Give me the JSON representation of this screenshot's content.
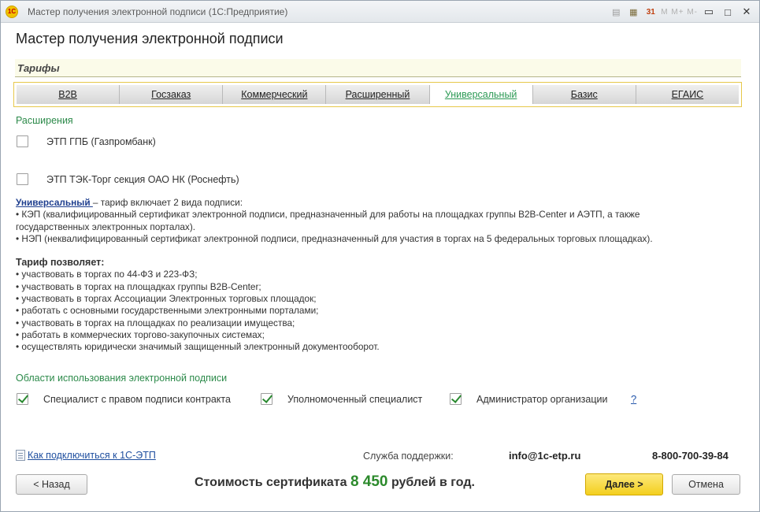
{
  "window": {
    "title": "Мастер получения электронной подписи  (1С:Предприятие)",
    "logo_text": "1C",
    "memory_buttons": "M  M+  M-",
    "calendar_day": "31"
  },
  "page": {
    "title": "Мастер получения электронной подписи",
    "tariffs_header": "Тарифы"
  },
  "tabs": [
    {
      "label": "B2B",
      "active": false
    },
    {
      "label": "Госзаказ",
      "active": false
    },
    {
      "label": "Коммерческий",
      "active": false
    },
    {
      "label": "Расширенный",
      "active": false
    },
    {
      "label": "Универсальный",
      "active": true
    },
    {
      "label": "Базис",
      "active": false
    },
    {
      "label": "ЕГАИС",
      "active": false
    }
  ],
  "extensions": {
    "label": "Расширения",
    "items": [
      {
        "label": "ЭТП ГПБ (Газпромбанк)",
        "checked": false
      },
      {
        "label": "ЭТП ТЭК-Торг секция ОАО НК (Роснефть)",
        "checked": false
      }
    ]
  },
  "description": {
    "keyword": "Универсальный ",
    "intro": " – тариф включает 2 вида подписи:",
    "bullets": [
      "• КЭП (квалифицированный сертификат электронной подписи, предназначенный для работы на площадках группы B2B-Center и АЭТП, а также",
      "государственных электронных порталах).",
      "• НЭП (неквалифицированный сертификат электронной подписи, предназначенный для участия в торгах на 5 федеральных торговых площадках)."
    ],
    "allows_title": "Тариф позволяет:",
    "allows": [
      "• участвовать в торгах по 44-ФЗ и 223-ФЗ;",
      "• участвовать в торгах на площадках группы B2B-Center;",
      "• участвовать в торгах Ассоциации Электронных торговых площадок;",
      "• работать с основными государственными электронными порталами;",
      "• участвовать в торгах на площадках по реализации имущества;",
      "• работать в коммерческих торгово-закупочных системах;",
      "• осуществлять юридически значимый защищенный электронный документооборот."
    ]
  },
  "usage": {
    "label": "Области использования электронной подписи",
    "items": [
      {
        "label": "Специалист с правом подписи контракта",
        "checked": true
      },
      {
        "label": "Уполномоченный специалист",
        "checked": true
      },
      {
        "label": "Администратор организации",
        "checked": true
      }
    ],
    "help": "?"
  },
  "footer": {
    "howto_link": "Как подключиться к 1С-ЭТП",
    "support_label": "Служба поддержки:",
    "support_email": "info@1c-etp.ru",
    "support_phone": "8-800-700-39-84",
    "price_prefix": "Стоимость сертификата ",
    "price_amount": "8 450",
    "price_suffix": " рублей в год."
  },
  "buttons": {
    "back": "< Назад",
    "next": "Далее >",
    "cancel": "Отмена"
  },
  "colors": {
    "accent_green": "#2c8a4a",
    "link_blue": "#1f4f9f",
    "primary_button": "#f3cf1e",
    "tab_frame": "#e6c84a"
  }
}
